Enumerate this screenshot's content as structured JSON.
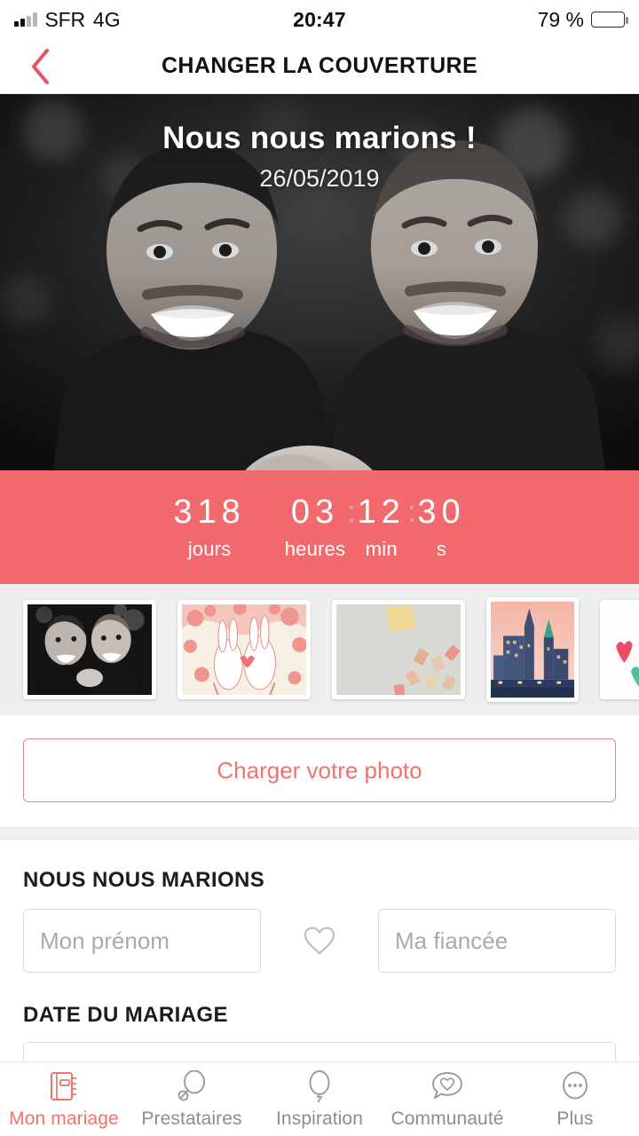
{
  "status_bar": {
    "carrier": "SFR",
    "network": "4G",
    "time": "20:47",
    "battery_percent": "79 %",
    "battery_level": 79,
    "signal_bars_filled": 2,
    "signal_bars_total": 4
  },
  "nav": {
    "back_icon": "chevron-left-icon",
    "title": "CHANGER LA COUVERTURE"
  },
  "hero": {
    "title": "Nous nous marions !",
    "date": "26/05/2019",
    "photo_description": "two-men-black-and-white-portrait"
  },
  "countdown": {
    "days": "318",
    "hours": "03",
    "minutes": "12",
    "seconds": "30",
    "separator": ":",
    "labels": {
      "days": "jours",
      "hours": "heures",
      "minutes": "min",
      "seconds": "s"
    },
    "background_color": "#F2696E"
  },
  "thumbnails": {
    "selected_index": 0,
    "items": [
      {
        "name": "couple-photo-thumbnail",
        "selected": true
      },
      {
        "name": "bunnies-illustration-thumbnail",
        "selected": false
      },
      {
        "name": "confetti-thumbnail",
        "selected": false
      },
      {
        "name": "city-skyline-thumbnail",
        "selected": false
      },
      {
        "name": "colorful-hearts-thumbnail",
        "selected": false
      },
      {
        "name": "partial-thumbnail",
        "selected": false
      }
    ]
  },
  "upload": {
    "label": "Charger votre photo",
    "accent_color": "#F0736F"
  },
  "form": {
    "couple_label": "NOUS NOUS MARIONS",
    "first_name_placeholder": "Mon prénom",
    "first_name_value": "",
    "partner_placeholder": "Ma fiancée",
    "partner_value": "",
    "heart_icon": "heart-outline-icon",
    "date_label": "DATE DU MARIAGE",
    "date_placeholder": "",
    "date_value": ""
  },
  "tabbar": {
    "active_index": 0,
    "active_color": "#F0736F",
    "inactive_color": "#8d8d8d",
    "items": [
      {
        "label": "Mon mariage",
        "icon": "notebook-icon"
      },
      {
        "label": "Prestataires",
        "icon": "magnifier-icon"
      },
      {
        "label": "Inspiration",
        "icon": "balloon-icon"
      },
      {
        "label": "Communauté",
        "icon": "speech-bubble-heart-icon"
      },
      {
        "label": "Plus",
        "icon": "ellipsis-circle-icon"
      }
    ]
  }
}
